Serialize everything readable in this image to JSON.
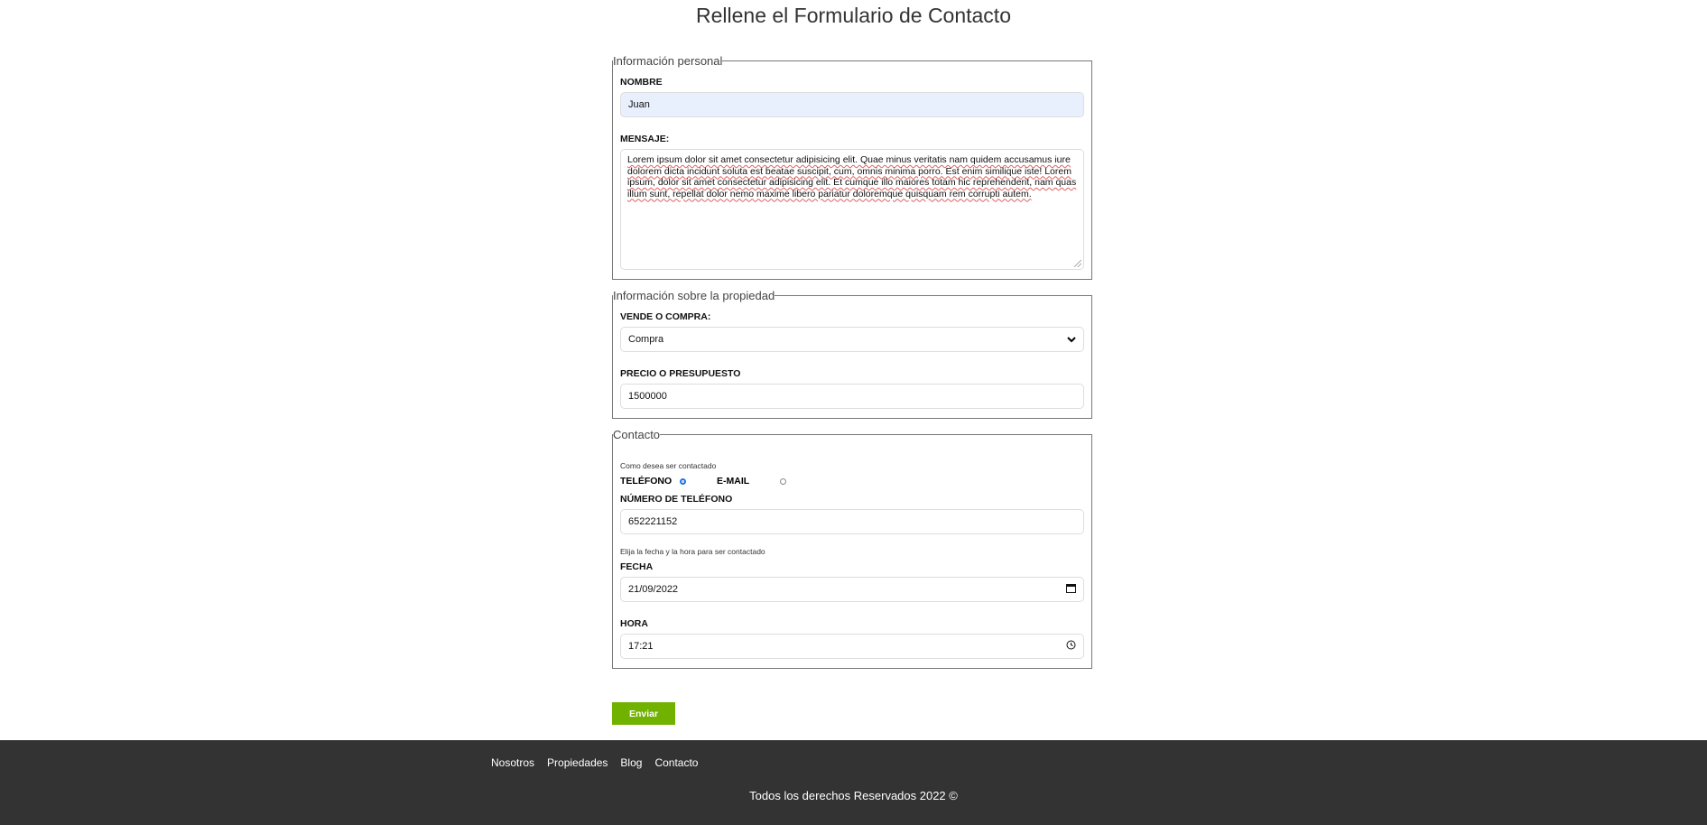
{
  "page": {
    "title": "Rellene el Formulario de Contacto"
  },
  "personal": {
    "legend": "Información personal",
    "name_label": "NOMBRE",
    "name_value": "Juan",
    "message_label": "MENSAJE:",
    "message_value": "Lorem ipsum dolor sit amet consectetur adipisicing elit. Quae minus veritatis nam quidem accusamus iure dolorem dicta incidunt soluta est beatae suscipit, cum, omnis minima porro. Est enim similique iste! Lorem ipsum, dolor sit amet consectetur adipisicing elit. Et cumque illo maiores totam hic reprehenderit, nam quas illum sunt, repellat dolor nemo maxime libero pariatur doloremque quisquam rem corrupti autem."
  },
  "property": {
    "legend": "Información sobre la propiedad",
    "type_label": "VENDE O COMPRA:",
    "type_selected": "Compra",
    "price_label": "PRECIO O PRESUPUESTO",
    "price_value": "1500000"
  },
  "contact": {
    "legend": "Contacto",
    "method_hint": "Como desea ser contactado",
    "phone_option": "TELÉFONO",
    "email_option": "E-MAIL",
    "selected_method": "phone",
    "phone_label": "NÚMERO DE TELÉFONO",
    "phone_value": "652221152",
    "datetime_hint": "Elija la fecha y la hora para ser contactado",
    "date_label": "FECHA",
    "date_value": "21/09/2022",
    "time_label": "HORA",
    "time_value": "17:21"
  },
  "form": {
    "submit_label": "Enviar"
  },
  "footer": {
    "nav": [
      "Nosotros",
      "Propiedades",
      "Blog",
      "Contacto"
    ],
    "copyright": "Todos los derechos Reservados 2022 ©"
  },
  "colors": {
    "accent": "#71b100",
    "footer_bg": "#333333",
    "radio_checked": "#1a73e8",
    "autofill_bg": "#e8f0fe"
  },
  "icons": {
    "select": "chevron-down-icon",
    "date": "calendar-icon",
    "time": "clock-icon"
  }
}
